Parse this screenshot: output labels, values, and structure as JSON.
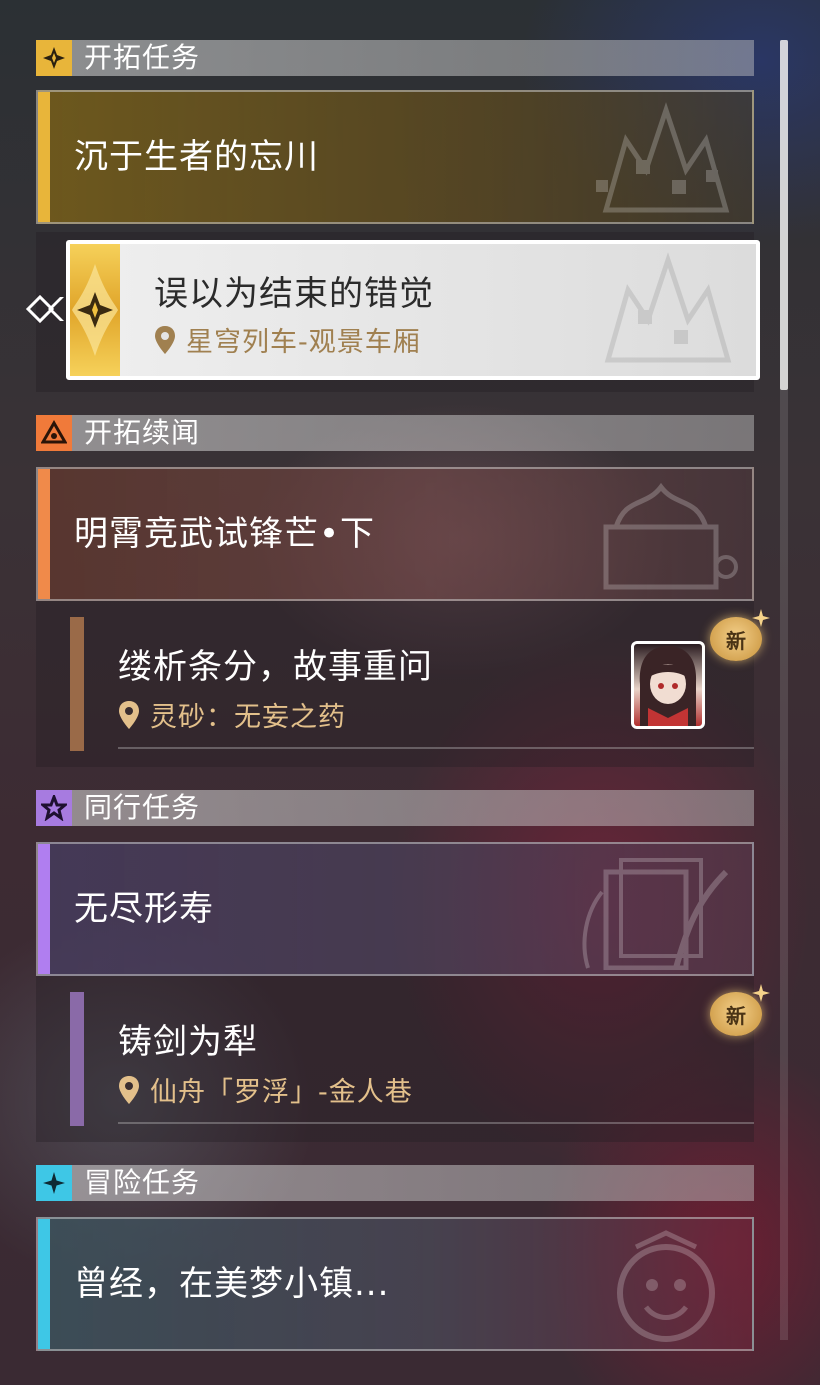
{
  "sections": [
    {
      "title": "开拓任务",
      "icon": "trailblaze-diamond-icon",
      "icon_bg": "#e8b53a",
      "main_label": "沉于生者的忘川",
      "stripe_color": "#e8b53a",
      "sub": {
        "title": "误以为结束的错觉",
        "location": "星穹列车-观景车厢",
        "selected": true
      }
    },
    {
      "title": "开拓续闻",
      "icon": "triangle-eye-icon",
      "icon_bg": "#f07a3a",
      "main_label": "明霄竞武试锋芒•下",
      "stripe_color": "#f08a4a",
      "sub": {
        "title": "缕析条分，故事重问",
        "location": "灵砂：无妄之药",
        "badge": "新",
        "bar_color": "#9a6a48"
      }
    },
    {
      "title": "同行任务",
      "icon": "star-icon",
      "icon_bg": "#a77be0",
      "main_label": "无尽形寿",
      "stripe_color": "#b07ef0",
      "sub": {
        "title": "铸剑为犁",
        "location": "仙舟「罗浮」-金人巷",
        "badge": "新",
        "bar_color": "#8a6aa8"
      }
    },
    {
      "title": "冒险任务",
      "icon": "sparkle-icon",
      "icon_bg": "#3ec7e6",
      "main_label": "曾经，在美梦小镇...",
      "stripe_color": "#3ec7e6"
    }
  ]
}
